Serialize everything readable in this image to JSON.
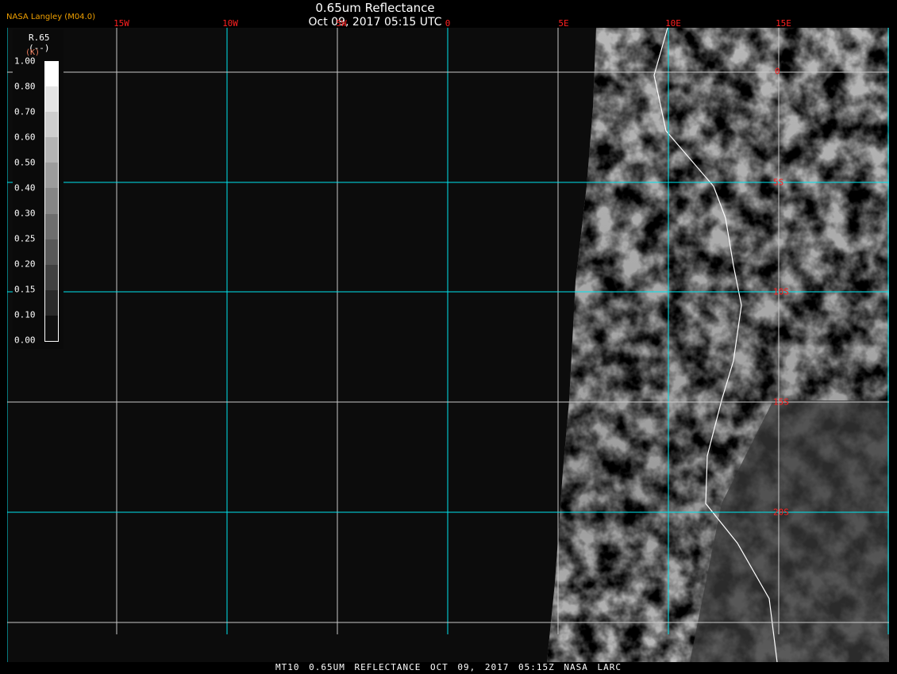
{
  "header": {
    "title": "0.65um Reflectance",
    "subtitle": "Oct 09, 2017 05:15 UTC",
    "brand": "NASA Langley (M04.0)"
  },
  "footer": {
    "caption": "MT10  0.65UM REFLECTANCE   OCT 09, 2017 05:15Z   NASA LARC"
  },
  "longitude_labels": [
    "15W",
    "10W",
    "5W",
    "0",
    "5E",
    "10E",
    "15E"
  ],
  "latitude_labels": [
    "0",
    "5S",
    "10S",
    "15S",
    "20S"
  ],
  "legend": {
    "title": "R.65",
    "unit": "(--)",
    "unit_overlay": "(K)",
    "ticks": [
      "1.00",
      "0.80",
      "0.70",
      "0.60",
      "0.50",
      "0.40",
      "0.30",
      "0.25",
      "0.20",
      "0.15",
      "0.10",
      "0.00"
    ],
    "colors": [
      "#ffffff",
      "#e4e4e4",
      "#cecece",
      "#b4b4b4",
      "#9c9c9c",
      "#868686",
      "#6e6e6e",
      "#585858",
      "#414141",
      "#2a2a2a",
      "#101010"
    ]
  },
  "colors": {
    "grid_major": "#00e5ee",
    "grid_minor": "#c8c8c8",
    "labels": "#ff2020",
    "brand": "#f0a000"
  }
}
